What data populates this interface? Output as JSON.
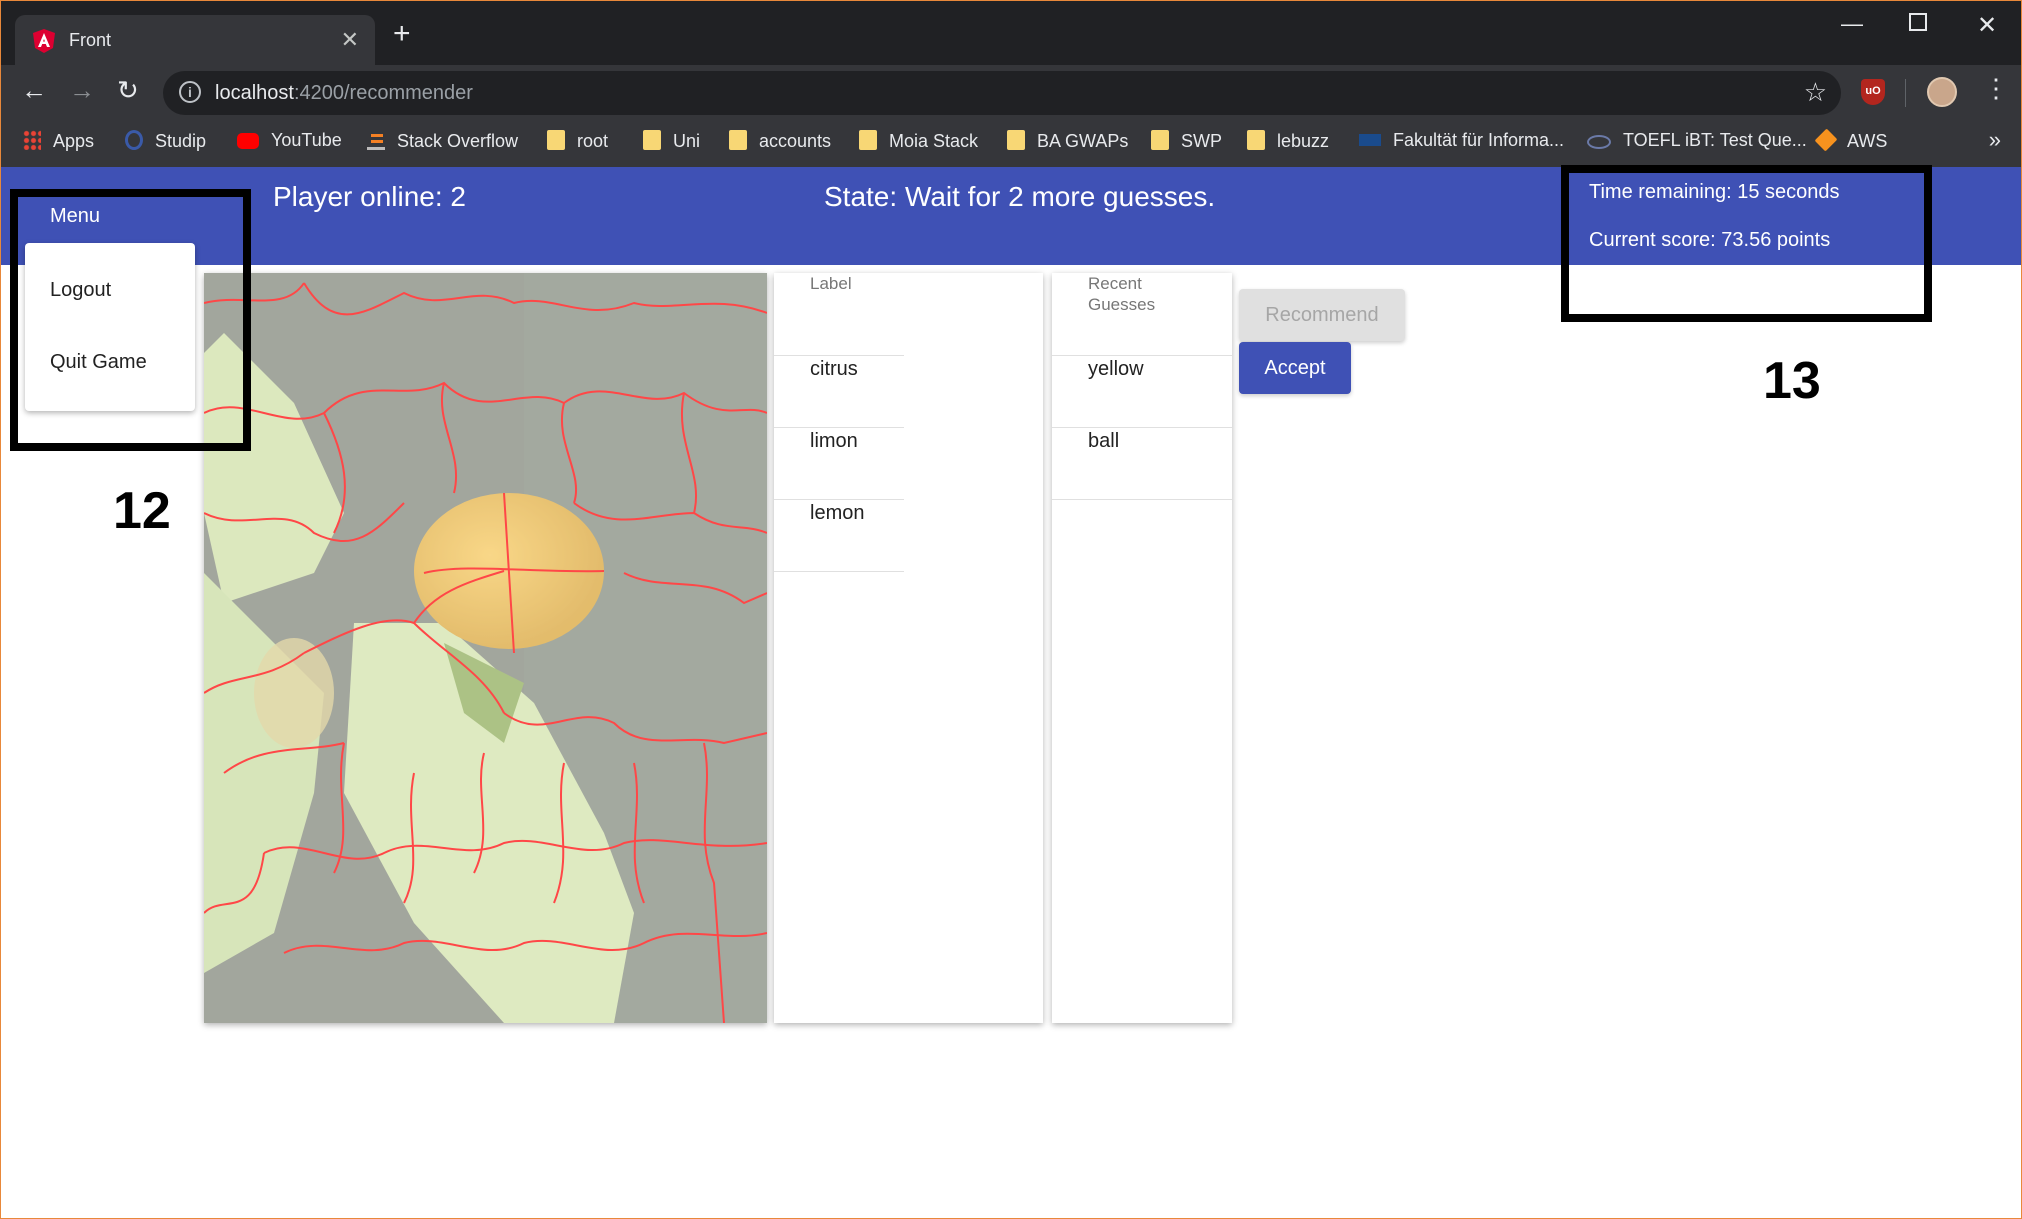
{
  "browser": {
    "tab_title": "Front",
    "url_host": "localhost",
    "url_path": ":4200/recommender",
    "extension_badge": "uO",
    "bookmarks": [
      "Apps",
      "Studip",
      "YouTube",
      "Stack Overflow",
      "root",
      "Uni",
      "accounts",
      "Moia Stack",
      "BA GWAPs",
      "SWP",
      "lebuzz",
      "Fakultät für Informa...",
      "TOEFL iBT: Test Que...",
      "AWS"
    ],
    "more_bookmarks": "»"
  },
  "app": {
    "menu_label": "Menu",
    "menu_items": [
      "Logout",
      "Quit Game"
    ],
    "players_online": "Player online: 2",
    "state": "State: Wait for 2 more guesses.",
    "time_remaining": "Time remaining: 15 seconds",
    "current_score": "Current score: 73.56 points",
    "label_column": {
      "header": "Label",
      "items": [
        "citrus",
        "limon",
        "lemon"
      ]
    },
    "guesses_column": {
      "header": "Recent Guesses",
      "items": [
        "yellow",
        "ball"
      ]
    },
    "recommend_button": "Recommend",
    "accept_button": "Accept",
    "image_subject": "lemon on tree with leaves, segmented into superpixels (red outlines)"
  },
  "annotations": {
    "menu_box_number": "12",
    "status_box_number": "13"
  },
  "colors": {
    "primary": "#3f51b5",
    "segment_outline": "#ff0000",
    "annotation": "#000000"
  }
}
